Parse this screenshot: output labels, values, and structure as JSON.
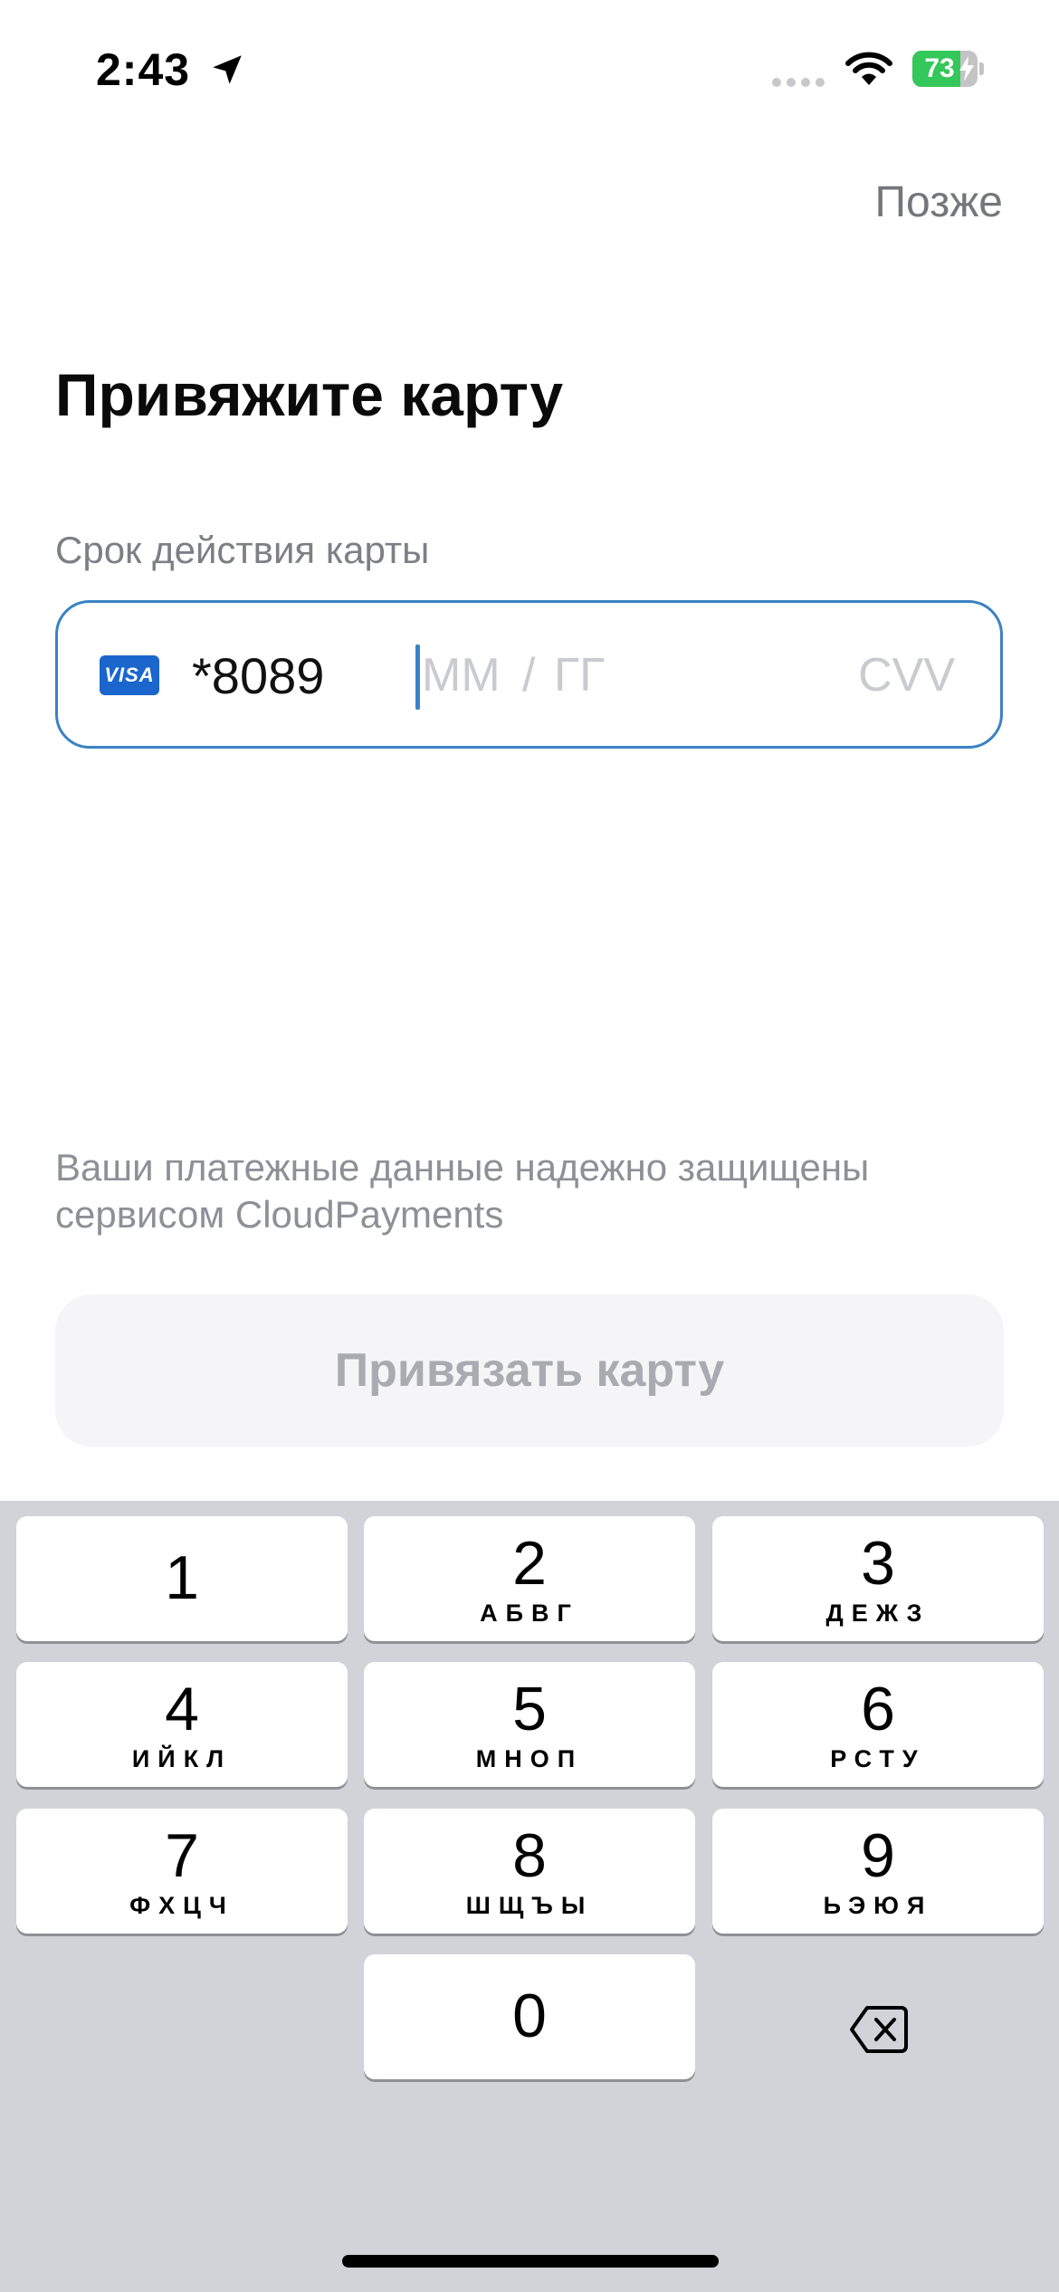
{
  "status_bar": {
    "time": "2:43",
    "battery_level": "73",
    "battery_fraction": 0.73
  },
  "header": {
    "later_label": "Позже",
    "title": "Привяжите карту"
  },
  "card_form": {
    "field_label": "Срок действия карты",
    "card_brand": "VISA",
    "card_last_digits": "*8089",
    "expiry_month_placeholder": "ММ",
    "expiry_separator": "/",
    "expiry_year_placeholder": "ГГ",
    "cvv_placeholder": "CVV"
  },
  "security_note": "Ваши платежные данные надежно защищены сервисом CloudPayments",
  "bind_button_label": "Привязать карту",
  "keypad": {
    "keys": [
      {
        "digit": "1",
        "letters": ""
      },
      {
        "digit": "2",
        "letters": "АБВГ"
      },
      {
        "digit": "3",
        "letters": "ДЕЖЗ"
      },
      {
        "digit": "4",
        "letters": "ИЙКЛ"
      },
      {
        "digit": "5",
        "letters": "МНОП"
      },
      {
        "digit": "6",
        "letters": "РСТУ"
      },
      {
        "digit": "7",
        "letters": "ФХЦЧ"
      },
      {
        "digit": "8",
        "letters": "ШЩЪЫ"
      },
      {
        "digit": "9",
        "letters": "ЬЭЮЯ"
      },
      {
        "digit": "0",
        "letters": ""
      }
    ]
  },
  "colors": {
    "accent": "#3b82c4",
    "battery_green": "#34c759",
    "keypad_background": "#d1d3d9",
    "visa_blue": "#1a66cc"
  },
  "icons": {
    "location": "location-arrow-icon",
    "signal": "cellular-signal-icon",
    "wifi": "wifi-icon",
    "battery_charging": "lightning-bolt-icon",
    "delete": "backspace-icon"
  }
}
